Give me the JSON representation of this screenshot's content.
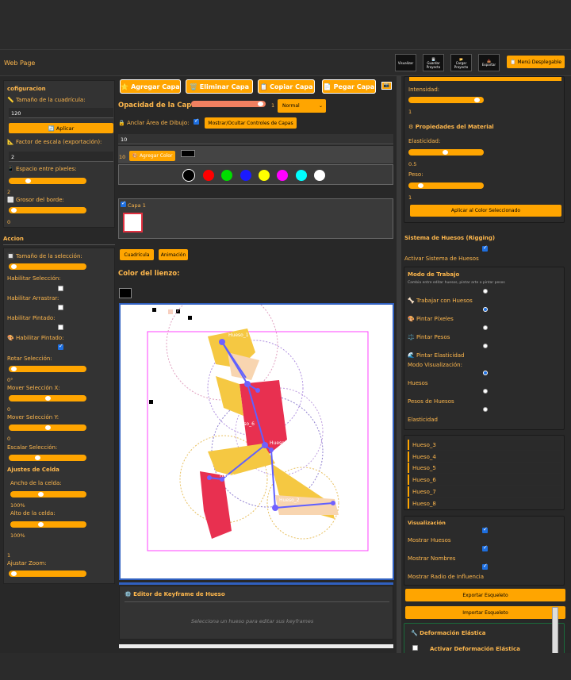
{
  "header": {
    "title": "Web Page",
    "menu": "📋 Menú Desplegable",
    "tools": [
      {
        "l1": "Visualizar",
        "l2": ""
      },
      {
        "l1": "💾",
        "l2": "Guardar Proyecto"
      },
      {
        "l1": "📂",
        "l2": "Cargar Proyecto"
      },
      {
        "l1": "📤",
        "l2": "Exportar"
      }
    ]
  },
  "left": {
    "config_title": "cofiguracion",
    "grid_size_label": "📏 Tamaño de la cuadrícula:",
    "grid_size_value": "120",
    "apply": "🔄 Aplicar",
    "scale_label": "📐 Factor de escala (exportación):",
    "scale_value": "2",
    "spacing_label": "📱 Espacio entre píxeles:",
    "spacing_value": "2",
    "border_label": "⬜ Grosor del borde:",
    "border_value": "0",
    "accion_title": "Accion",
    "sel_size_label": "🔲 Tamaño de la selección:",
    "en_sel": "Habilitar Selección:",
    "en_drag": "Habilitar Arrastrar:",
    "en_paint": "Habilitar Pintado:",
    "en_paint2": "🎨 Habilitar Pintado:",
    "rotate_label": "Rotar Selección:",
    "rotate_value": "0°",
    "movex_label": "Mover Selección X:",
    "movex_value": "0",
    "movey_label": "Mover Selección Y:",
    "movey_value": "0",
    "scalesel_label": "Escalar Selección:",
    "cell_title": "Ajustes de Celda",
    "cell_w_label": "Ancho de la celda:",
    "cell_w_value": "100%",
    "cell_h_label": "Alto de la celda:",
    "cell_h_value": "100%",
    "zoom_value": "1",
    "zoom_label": "Ajustar Zoom:"
  },
  "mid": {
    "add_layer": "⭐ Agregar Capa",
    "del_layer": "🗑️ Eliminar Capa",
    "copy_layer": "📋 Copiar Capa",
    "paste_layer": "📄 Pegar Capa",
    "opacity_label": "Opacidad de la Capa:",
    "opacity_value": "1",
    "blend": "Normal",
    "anchor_label": "🔒 Anclar Área de Dibujo:",
    "toggle_layers": "Mostrar/Ocultar Controles de Capas",
    "input_value": "10",
    "color_count": "10",
    "add_color": "🎨 Agregar Color",
    "palette": [
      "#000000",
      "#ff0000",
      "#00dd00",
      "#1a1aff",
      "#ffff00",
      "#ff00ff",
      "#00ffff",
      "#ffffff"
    ],
    "layer_name": "Capa 1",
    "tab_grid": "Cuadrícula",
    "tab_anim": "Animación",
    "canvas_color_label": "Color del lienzo:",
    "bones": [
      "Hueso_1",
      "hueso_6",
      "Hueso_4",
      "Hueso_7",
      "Hueso_2"
    ],
    "keyframe_title": "⚙️ Editor de Keyframe de Hueso",
    "keyframe_hint": "Selecciona un hueso para editar sus keyframes"
  },
  "right": {
    "intensity_label": "Intensidad:",
    "intensity_value": "1",
    "material_title": "⚙ Propiedades del Material",
    "elastic_label": "Elasticidad:",
    "elastic_value": "0.5",
    "weight_label": "Peso:",
    "weight_value": "1",
    "apply_color": "Aplicar al Color Seleccionado",
    "bones_title": "Sistema de Huesos (Rigging)",
    "enable_bones": "Activar Sistema de Huesos",
    "mode_title": "Modo de Trabajo",
    "mode_hint": "Cambia entre editar huesos, pintar arte o pintar pesos",
    "work_bones": "🦴 Trabajar con Huesos",
    "paint_px": "🎨 Pintar Píxeles",
    "paint_w": "⚖️ Pintar Pesos",
    "paint_e": "🌊 Pintar Elasticidad",
    "vis_mode": "Modo Visualización:",
    "vis_bones": "Huesos",
    "vis_weights": "Pesos de Huesos",
    "vis_elastic": "Elasticidad",
    "bone_list": [
      "Hueso_3",
      "Hueso_4",
      "Hueso_5",
      "Hueso_6",
      "Hueso_7",
      "Hueso_8"
    ],
    "viz_title": "Visualización",
    "show_bones": "Mostrar Huesos",
    "show_names": "Mostrar Nombres",
    "show_radius": "Mostrar Radio de Influencia",
    "export_skel": "Exportar Esqueleto",
    "import_skel": "Importar Esqueleto",
    "deform_title": "🔧 Deformación Elástica",
    "deform_enable": "Activar Deformación Elástica"
  }
}
